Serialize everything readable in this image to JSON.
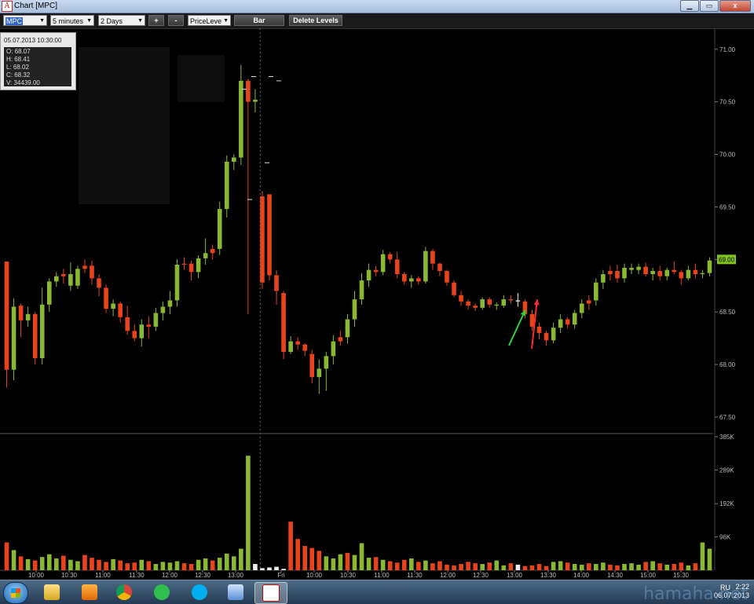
{
  "window": {
    "title": "Chart [MPC]",
    "min_label": "▁",
    "max_label": "▭",
    "close_label": "x"
  },
  "toolbar": {
    "symbol": "MPC",
    "interval": "5 minutes",
    "period": "2 Days",
    "zoom_in": "+",
    "zoom_out": "-",
    "tool": "PriceLeve",
    "style_button": "Bar",
    "delete_levels": "Delete Levels"
  },
  "ohlc": {
    "datetime": "05.07.2013 10:30:00",
    "open": "O: 68.07",
    "high": "H: 68.41",
    "low": "L: 68.02",
    "close": "C: 68.32",
    "volume": "V: 34439.00"
  },
  "chart_data": {
    "type": "candlestick",
    "symbol": "MPC",
    "interval": "5 minutes",
    "price_axis": {
      "ticks": [
        "71.00",
        "70.50",
        "70.00",
        "69.50",
        "69.00",
        "68.50",
        "68.00",
        "67.50"
      ],
      "range": [
        67.35,
        71.2
      ]
    },
    "current_price_label": "69.00",
    "volume_axis": {
      "ticks": [
        "385K",
        "289K",
        "192K",
        "96K"
      ],
      "range": [
        0,
        385
      ]
    },
    "time_ticks": [
      "10:00",
      "10:30",
      "11:00",
      "11:30",
      "12:00",
      "12:30",
      "13:00",
      "Fri",
      "10:00",
      "10:30",
      "11:00",
      "11:30",
      "12:00",
      "12:30",
      "13:00",
      "13:30",
      "14:00",
      "14:30",
      "15:00",
      "15:30"
    ],
    "day_separator_label": "Fri",
    "colors": {
      "up": "#8ab832",
      "down": "#e8431c",
      "neutral": "#eeeeee",
      "price_label": "#7fc31c"
    },
    "candles": [
      [
        68.98,
        68.98,
        67.78,
        67.95,
        "d"
      ],
      [
        67.95,
        68.63,
        67.85,
        68.55,
        "u"
      ],
      [
        68.56,
        68.58,
        68.26,
        68.42,
        "d"
      ],
      [
        68.42,
        68.55,
        68.36,
        68.48,
        "u"
      ],
      [
        68.48,
        68.5,
        68.0,
        68.06,
        "d"
      ],
      [
        68.06,
        68.73,
        68.0,
        68.57,
        "u"
      ],
      [
        68.57,
        68.82,
        68.5,
        68.79,
        "u"
      ],
      [
        68.79,
        68.88,
        68.74,
        68.84,
        "u"
      ],
      [
        68.84,
        68.91,
        68.77,
        68.86,
        "d"
      ],
      [
        68.86,
        68.97,
        68.7,
        68.75,
        "u"
      ],
      [
        68.75,
        68.94,
        68.72,
        68.91,
        "u"
      ],
      [
        68.91,
        69.0,
        68.87,
        68.94,
        "d"
      ],
      [
        68.94,
        68.99,
        68.76,
        68.82,
        "d"
      ],
      [
        68.82,
        68.86,
        68.65,
        68.73,
        "d"
      ],
      [
        68.73,
        68.76,
        68.49,
        68.53,
        "d"
      ],
      [
        68.53,
        68.62,
        68.46,
        68.58,
        "u"
      ],
      [
        68.58,
        68.6,
        68.4,
        68.45,
        "d"
      ],
      [
        68.45,
        68.56,
        68.28,
        68.32,
        "d"
      ],
      [
        68.32,
        68.38,
        68.22,
        68.25,
        "d"
      ],
      [
        68.25,
        68.43,
        68.17,
        68.38,
        "u"
      ],
      [
        68.38,
        68.46,
        68.25,
        68.36,
        "d"
      ],
      [
        68.36,
        68.54,
        68.32,
        68.49,
        "u"
      ],
      [
        68.49,
        68.6,
        68.42,
        68.55,
        "u"
      ],
      [
        68.55,
        68.7,
        68.48,
        68.61,
        "u"
      ],
      [
        68.61,
        69.0,
        68.55,
        68.95,
        "u"
      ],
      [
        68.95,
        69.02,
        68.9,
        68.96,
        "d"
      ],
      [
        68.96,
        68.99,
        68.8,
        68.88,
        "d"
      ],
      [
        68.88,
        69.04,
        68.82,
        69.01,
        "u"
      ],
      [
        69.01,
        69.2,
        68.95,
        69.06,
        "u"
      ],
      [
        69.06,
        69.14,
        69.0,
        69.1,
        "d"
      ],
      [
        69.1,
        69.55,
        69.04,
        69.48,
        "u"
      ],
      [
        69.48,
        69.99,
        69.4,
        69.93,
        "u"
      ],
      [
        69.93,
        70.0,
        69.85,
        69.97,
        "u"
      ],
      [
        69.97,
        70.85,
        69.9,
        70.7,
        "u"
      ],
      [
        70.7,
        70.72,
        68.48,
        70.5,
        "d"
      ],
      [
        70.5,
        70.62,
        70.4,
        70.52,
        "u"
      ],
      [
        69.6,
        69.65,
        68.72,
        68.78,
        "d"
      ],
      [
        69.62,
        69.62,
        68.8,
        68.85,
        "d"
      ],
      [
        68.85,
        68.9,
        68.57,
        68.7,
        "d"
      ],
      [
        68.68,
        68.7,
        68.05,
        68.12,
        "d"
      ],
      [
        68.12,
        68.27,
        68.1,
        68.22,
        "u"
      ],
      [
        68.22,
        68.26,
        68.14,
        68.19,
        "d"
      ],
      [
        68.19,
        68.2,
        68.08,
        68.13,
        "d"
      ],
      [
        68.1,
        68.14,
        67.82,
        67.88,
        "d"
      ],
      [
        67.88,
        68.05,
        67.72,
        67.96,
        "u"
      ],
      [
        67.96,
        68.12,
        67.75,
        68.08,
        "u"
      ],
      [
        68.08,
        68.28,
        68.0,
        68.22,
        "u"
      ],
      [
        68.22,
        68.32,
        68.18,
        68.26,
        "d"
      ],
      [
        68.26,
        68.48,
        68.2,
        68.43,
        "u"
      ],
      [
        68.43,
        68.7,
        68.36,
        68.62,
        "u"
      ],
      [
        68.62,
        68.87,
        68.57,
        68.8,
        "u"
      ],
      [
        68.8,
        68.96,
        68.74,
        68.9,
        "u"
      ],
      [
        68.9,
        68.94,
        68.84,
        68.88,
        "d"
      ],
      [
        68.88,
        69.09,
        68.85,
        69.05,
        "u"
      ],
      [
        69.05,
        69.07,
        68.96,
        69.0,
        "d"
      ],
      [
        69.0,
        69.07,
        68.82,
        68.86,
        "d"
      ],
      [
        68.86,
        68.88,
        68.76,
        68.79,
        "d"
      ],
      [
        68.79,
        68.85,
        68.73,
        68.82,
        "u"
      ],
      [
        68.82,
        68.84,
        68.76,
        68.79,
        "d"
      ],
      [
        68.79,
        69.12,
        68.77,
        69.08,
        "u"
      ],
      [
        69.08,
        69.1,
        68.9,
        68.96,
        "d"
      ],
      [
        68.96,
        68.97,
        68.84,
        68.89,
        "d"
      ],
      [
        68.89,
        68.9,
        68.75,
        68.78,
        "d"
      ],
      [
        68.78,
        68.8,
        68.64,
        68.66,
        "d"
      ],
      [
        68.66,
        68.7,
        68.56,
        68.6,
        "d"
      ],
      [
        68.6,
        68.62,
        68.52,
        68.56,
        "d"
      ],
      [
        68.56,
        68.58,
        68.51,
        68.54,
        "d"
      ],
      [
        68.54,
        68.64,
        68.52,
        68.62,
        "u"
      ],
      [
        68.62,
        68.64,
        68.54,
        68.57,
        "d"
      ],
      [
        68.57,
        68.59,
        68.52,
        68.56,
        "u"
      ],
      [
        68.56,
        68.66,
        68.54,
        68.62,
        "u"
      ],
      [
        68.62,
        68.66,
        68.58,
        68.61,
        "d"
      ],
      [
        68.61,
        68.68,
        68.55,
        68.6,
        "n"
      ],
      [
        68.6,
        68.62,
        68.44,
        68.48,
        "d"
      ],
      [
        68.48,
        68.52,
        68.32,
        68.36,
        "d"
      ],
      [
        68.36,
        68.4,
        68.24,
        68.3,
        "d"
      ],
      [
        68.3,
        68.32,
        68.18,
        68.23,
        "d"
      ],
      [
        68.23,
        68.4,
        68.2,
        68.35,
        "u"
      ],
      [
        68.35,
        68.48,
        68.3,
        68.43,
        "u"
      ],
      [
        68.43,
        68.45,
        68.34,
        68.38,
        "d"
      ],
      [
        68.38,
        68.52,
        68.34,
        68.49,
        "u"
      ],
      [
        68.49,
        68.62,
        68.44,
        68.58,
        "u"
      ],
      [
        68.58,
        68.66,
        68.52,
        68.61,
        "d"
      ],
      [
        68.61,
        68.82,
        68.56,
        68.78,
        "u"
      ],
      [
        68.78,
        68.9,
        68.72,
        68.86,
        "u"
      ],
      [
        68.86,
        68.94,
        68.8,
        68.89,
        "d"
      ],
      [
        68.89,
        68.95,
        68.78,
        68.82,
        "d"
      ],
      [
        68.82,
        68.96,
        68.78,
        68.92,
        "u"
      ],
      [
        68.92,
        68.96,
        68.86,
        68.9,
        "u"
      ],
      [
        68.9,
        68.96,
        68.86,
        68.93,
        "u"
      ],
      [
        68.93,
        68.97,
        68.84,
        68.86,
        "d"
      ],
      [
        68.86,
        68.92,
        68.8,
        68.89,
        "u"
      ],
      [
        68.89,
        68.94,
        68.8,
        68.84,
        "d"
      ],
      [
        68.84,
        68.92,
        68.8,
        68.9,
        "u"
      ],
      [
        68.9,
        68.98,
        68.86,
        68.88,
        "d"
      ],
      [
        68.88,
        68.9,
        68.76,
        68.82,
        "d"
      ],
      [
        68.82,
        68.94,
        68.8,
        68.9,
        "u"
      ],
      [
        68.9,
        68.96,
        68.82,
        68.86,
        "d"
      ],
      [
        68.86,
        68.9,
        68.82,
        68.87,
        "u"
      ],
      [
        68.87,
        69.02,
        68.84,
        68.99,
        "u"
      ]
    ],
    "volumes": [
      80,
      58,
      40,
      32,
      28,
      38,
      46,
      34,
      42,
      30,
      26,
      44,
      36,
      30,
      24,
      32,
      28,
      20,
      22,
      30,
      26,
      18,
      24,
      22,
      26,
      20,
      18,
      30,
      34,
      28,
      36,
      48,
      40,
      62,
      330,
      18,
      6,
      8,
      10,
      4,
      140,
      90,
      70,
      64,
      56,
      40,
      34,
      46,
      50,
      44,
      78,
      36,
      38,
      30,
      26,
      22,
      30,
      34,
      24,
      28,
      20,
      26,
      16,
      14,
      18,
      24,
      20,
      18,
      22,
      28,
      14,
      20,
      16,
      12,
      14,
      18,
      12,
      24,
      26,
      22,
      18,
      16,
      20,
      18,
      22,
      16,
      14,
      18,
      20,
      16,
      24,
      26,
      20,
      16,
      18,
      22,
      14,
      20,
      80,
      62
    ],
    "volume_colors": [
      "d",
      "u",
      "d",
      "u",
      "d",
      "u",
      "u",
      "u",
      "d",
      "u",
      "u",
      "d",
      "d",
      "d",
      "d",
      "u",
      "d",
      "d",
      "d",
      "u",
      "d",
      "u",
      "u",
      "u",
      "u",
      "d",
      "d",
      "u",
      "u",
      "d",
      "u",
      "u",
      "u",
      "u",
      "u",
      "n",
      "n",
      "n",
      "n",
      "n",
      "d",
      "d",
      "d",
      "d",
      "d",
      "u",
      "u",
      "u",
      "d",
      "u",
      "u",
      "u",
      "d",
      "u",
      "d",
      "d",
      "d",
      "u",
      "d",
      "u",
      "d",
      "d",
      "d",
      "d",
      "d",
      "d",
      "d",
      "u",
      "d",
      "u",
      "u",
      "d",
      "n",
      "d",
      "d",
      "d",
      "d",
      "u",
      "u",
      "d",
      "u",
      "u",
      "d",
      "u",
      "u",
      "d",
      "d",
      "u",
      "u",
      "u",
      "d",
      "u",
      "d",
      "u",
      "d",
      "d",
      "u",
      "d",
      "u",
      "u"
    ],
    "level_marks": [
      [
        70.74,
        323
      ],
      [
        70.74,
        345
      ],
      [
        70.7,
        355
      ],
      [
        70.62,
        311
      ],
      [
        69.92,
        340
      ],
      [
        69.57,
        318
      ]
    ],
    "arrows": [
      {
        "color": "#35d035",
        "from": [
          68.18,
          648
        ],
        "to": [
          68.52,
          669
        ]
      },
      {
        "color": "#ff2a2a",
        "from": [
          68.15,
          677
        ],
        "to": [
          68.62,
          684
        ]
      }
    ]
  },
  "taskbar": {
    "apps": [
      "explorer",
      "media-player",
      "chrome",
      "at-client",
      "skype",
      "window-manager",
      "trading-app"
    ],
    "lang": "RU",
    "time": "2:22",
    "date": "06.07.2013"
  },
  "watermark": "hamaha.net"
}
